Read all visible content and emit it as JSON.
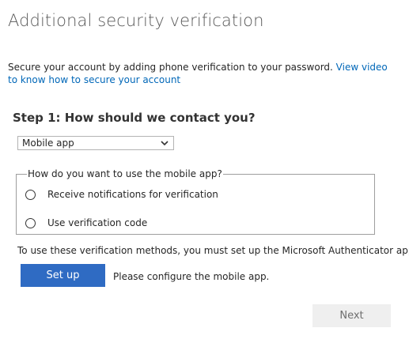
{
  "page": {
    "title": "Additional security verification"
  },
  "intro": {
    "text": "Secure your account by adding phone verification to your password. ",
    "link_text": "View video to know how to secure your account"
  },
  "step1": {
    "heading": "Step 1: How should we contact you?",
    "method_select": {
      "selected": "Mobile app",
      "icon": "chevron-down-icon"
    }
  },
  "mobile_app": {
    "legend": "How do you want to use the mobile app?",
    "options": [
      {
        "label": "Receive notifications for verification",
        "selected": false
      },
      {
        "label": "Use verification code",
        "selected": false
      }
    ],
    "info": "To use these verification methods, you must set up the Microsoft Authenticator app.",
    "setup_button": "Set up",
    "setup_hint": "Please configure the mobile app."
  },
  "footer": {
    "next_button": "Next"
  },
  "colors": {
    "accent": "#2f6bc3",
    "link": "#0067b8",
    "title": "#595959",
    "disabled_bg": "#efefef"
  }
}
